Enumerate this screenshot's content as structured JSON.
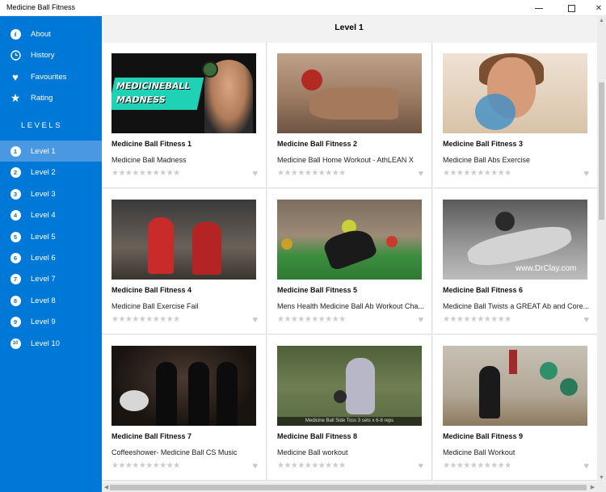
{
  "window": {
    "title": "Medicine Ball Fitness",
    "minimize_icon": "minimize-icon",
    "maximize_icon": "maximize-icon",
    "close_icon": "close-icon"
  },
  "colors": {
    "sidebar_bg": "#0078d7",
    "sidebar_selected": "#4a98e1",
    "main_bg": "#f2f2f2",
    "star_empty": "#cccccc"
  },
  "sidebar": {
    "menu": [
      {
        "label": "About",
        "icon": "info-icon"
      },
      {
        "label": "History",
        "icon": "clock-icon"
      },
      {
        "label": "Favourites",
        "icon": "heart-icon"
      },
      {
        "label": "Rating",
        "icon": "star-icon"
      }
    ],
    "levels_heading": "LEVELS",
    "levels": [
      {
        "number": "1",
        "label": "Level 1",
        "selected": true
      },
      {
        "number": "2",
        "label": "Level 2"
      },
      {
        "number": "3",
        "label": "Level 3"
      },
      {
        "number": "4",
        "label": "Level 4"
      },
      {
        "number": "5",
        "label": "Level 5"
      },
      {
        "number": "6",
        "label": "Level 6"
      },
      {
        "number": "7",
        "label": "Level 7"
      },
      {
        "number": "8",
        "label": "Level 8"
      },
      {
        "number": "9",
        "label": "Level 9"
      },
      {
        "number": "10",
        "label": "Level 10"
      }
    ]
  },
  "main": {
    "title": "Level 1",
    "videos": [
      {
        "title": "Medicine Ball Fitness 1",
        "subtitle": "Medicine Ball Madness",
        "thumb_text": "MEDICINEBALL MADNESS",
        "rating": 0
      },
      {
        "title": "Medicine Ball Fitness 2",
        "subtitle": "Medicine Ball Home Workout - AthLEAN X",
        "rating": 0
      },
      {
        "title": "Medicine Ball Fitness 3",
        "subtitle": "Medicine Ball Abs Exercise",
        "rating": 0
      },
      {
        "title": "Medicine Ball Fitness 4",
        "subtitle": "Medicine Ball Exercise Fail",
        "rating": 0
      },
      {
        "title": "Medicine Ball Fitness 5",
        "subtitle": "Mens Health Medicine Ball Ab Workout Cha...",
        "rating": 0
      },
      {
        "title": "Medicine Ball Fitness 6",
        "subtitle": "Medicine Ball Twists a GREAT Ab and Core...",
        "thumb_text": "www.DrClay.com",
        "rating": 0
      },
      {
        "title": "Medicine Ball Fitness 7",
        "subtitle": "Coffeeshower- Medicine Ball CS Music",
        "rating": 0
      },
      {
        "title": "Medicine Ball Fitness 8",
        "subtitle": "Medicine Ball workout",
        "thumb_text": "Medicine Ball Side Toss 3 sets x 6-8 reps",
        "rating": 0
      },
      {
        "title": "Medicine Ball Fitness 9",
        "subtitle": "Medicine Ball Workout",
        "rating": 0
      }
    ]
  }
}
